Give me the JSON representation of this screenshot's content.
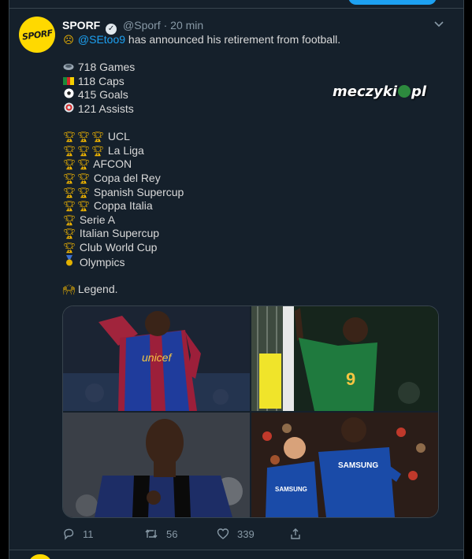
{
  "previous": {
    "text": ""
  },
  "tweet": {
    "avatar_text": "SPORF",
    "name": "SPORF",
    "handle": "@Sporf",
    "dot": "·",
    "time": "20 min",
    "mention": "@SEtoo9",
    "intro": " has announced his retirement from football.",
    "stats": [
      {
        "icon": "stadium",
        "text": "718 Games"
      },
      {
        "icon": "cameroon-flag",
        "text": "118 Caps"
      },
      {
        "icon": "soccer-ball",
        "text": "415 Goals"
      },
      {
        "icon": "target",
        "text": "121 Assists"
      }
    ],
    "trophies": [
      {
        "count": 3,
        "text": "UCL"
      },
      {
        "count": 3,
        "text": "La Liga"
      },
      {
        "count": 2,
        "text": "AFCON"
      },
      {
        "count": 2,
        "text": "Copa del Rey"
      },
      {
        "count": 2,
        "text": "Spanish Supercup"
      },
      {
        "count": 2,
        "text": "Coppa Italia"
      },
      {
        "count": 1,
        "text": "Serie A"
      },
      {
        "count": 1,
        "text": "Italian Supercup"
      },
      {
        "count": 1,
        "text": "Club World Cup"
      },
      {
        "count": 1,
        "icon": "medal",
        "text": "Olympics"
      }
    ],
    "closing": "Legend.",
    "watermark": {
      "left": "meczyki",
      "right": "pl"
    },
    "media_icons": [
      "barcelona-player-photo",
      "cameroon-player-photo",
      "inter-player-photo",
      "chelsea-player-photo"
    ],
    "shirt_texts": {
      "barcelona": "unicef",
      "cameroon": "9",
      "chelsea": "SAMSUNG"
    },
    "actions": {
      "replies": "11",
      "retweets": "56",
      "likes": "339"
    }
  },
  "colors": {
    "background": "#15202b",
    "accent": "#1da1f2",
    "text": "#d9d9d9",
    "muted": "#8899a6",
    "avatar": "#ffd900"
  }
}
